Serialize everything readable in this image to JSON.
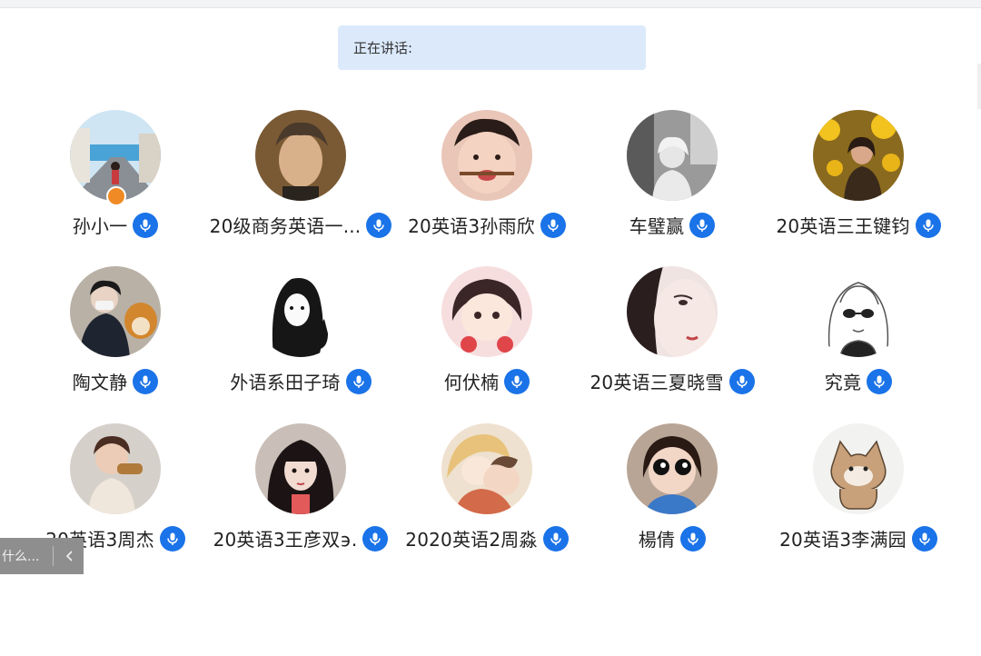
{
  "speaking_label": "正在讲话:",
  "members": [
    {
      "name": "孙小一",
      "host": true,
      "avatar": "photo-girl-seaside-street"
    },
    {
      "name": "20级商务英语一...",
      "host": false,
      "avatar": "portrait-beethoven-painting"
    },
    {
      "name": "20英语3孙雨欣",
      "host": false,
      "avatar": "photo-child-smiling"
    },
    {
      "name": "车璧赢",
      "host": false,
      "avatar": "photo-girl-black-white"
    },
    {
      "name": "20英语三王键钧",
      "host": false,
      "avatar": "photo-sunflowers-girl"
    },
    {
      "name": "陶文静",
      "host": false,
      "avatar": "photo-boy-mask-cat"
    },
    {
      "name": "外语系田子琦",
      "host": false,
      "avatar": "drawing-girl-black-cat"
    },
    {
      "name": "何伏楠",
      "host": false,
      "avatar": "cartoon-girl-strawberries"
    },
    {
      "name": "20英语三夏晓雪",
      "host": false,
      "avatar": "photo-girl-face-closeup"
    },
    {
      "name": "究竟",
      "host": false,
      "avatar": "sketch-girl-sunglasses"
    },
    {
      "name": "20英语3周杰",
      "host": false,
      "avatar": "photo-toddler-eating"
    },
    {
      "name": "20英语3王彦双϶.",
      "host": false,
      "avatar": "photo-girl-bangs"
    },
    {
      "name": "2020英语2周淼",
      "host": false,
      "avatar": "anime-girls-hug"
    },
    {
      "name": "楊倩",
      "host": false,
      "avatar": "photo-girl-big-eyes"
    },
    {
      "name": "20英语3李满园",
      "host": false,
      "avatar": "cartoon-cinnamoroll-dog"
    }
  ],
  "overlay": {
    "text": "什么...",
    "button_icon": "chevron-left-icon"
  },
  "colors": {
    "speaking_bg": "#dbe9fb",
    "mic_blue": "#1a73e8",
    "host_badge": "#f08a24"
  },
  "icons": {
    "mic": "microphone-icon",
    "host": "host-person-icon"
  }
}
